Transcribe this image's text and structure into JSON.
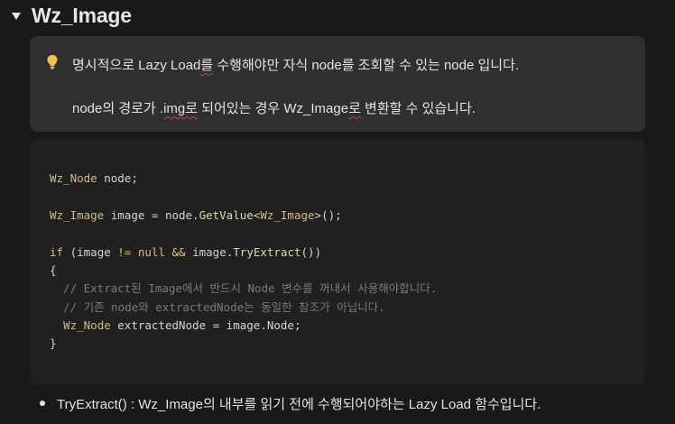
{
  "heading": {
    "title": "Wz_Image"
  },
  "callout": {
    "icon": "lightbulb-icon",
    "line1": {
      "a": "명시적으로 ",
      "b": "Lazy Load",
      "c": "를",
      "d": " 수행해야만 자식 node를 조회할 수 있는 node 입니다."
    },
    "line2": {
      "a": "node의 경로가 .",
      "b": "img로",
      "c": " 되어있는 경우 Wz_Image",
      "d": "로",
      "e": " 변환할 수 있습니다."
    }
  },
  "code": {
    "l1": {
      "type": "Wz_Node",
      "rest": " node;"
    },
    "l2": {
      "type": "Wz_Image",
      "a": " image = node.",
      "fn": "GetValue",
      "lt": "<",
      "type2": "Wz_Image",
      "gt": ">",
      "end": "();"
    },
    "l3": {
      "kw": "if",
      "a": " (image ",
      "op1": "!=",
      "b": " ",
      "null": "null",
      "c": " ",
      "op2": "&&",
      "d": " image.",
      "fn": "TryExtract",
      "end": "())"
    },
    "l4": "{",
    "l5": "  // Extract된 Image에서 반드시 Node 변수를 꺼내서 사용해야합니다.",
    "l6": "  // 기존 node와 extractedNode는 동일한 참조가 아닙니다.",
    "l7": {
      "indent": "  ",
      "type": "Wz_Node",
      "rest": " extractedNode = image.Node;"
    },
    "l8": "}"
  },
  "bullet": {
    "text": "TryExtract() : Wz_Image의 내부를 읽기 전에 수행되어야하는 Lazy Load 함수입니다."
  },
  "colors": {
    "background": "#191919",
    "callout_bg": "#2f2f2f",
    "code_bg": "#202020",
    "type": "#d7ba7d",
    "function": "#dcdcaa",
    "comment": "#7a7a7a"
  }
}
